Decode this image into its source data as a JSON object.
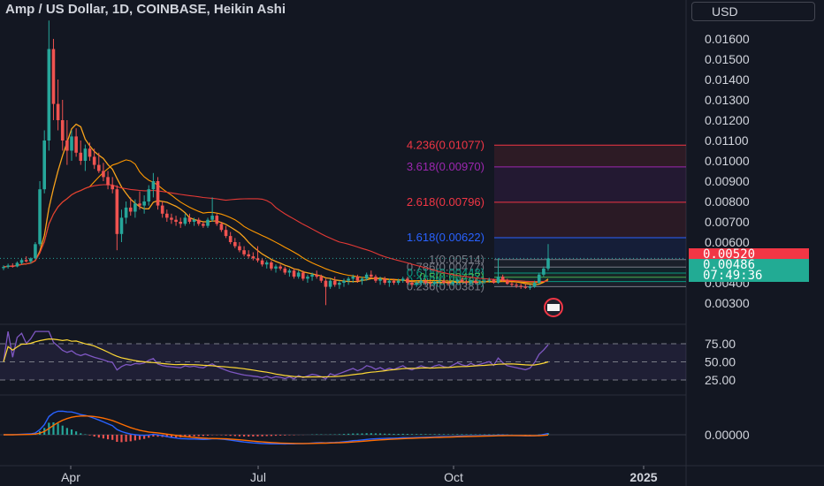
{
  "header": {
    "title": "Amp / US Dollar, 1D, COINBASE, Heikin Ashi",
    "currency_button": "USD"
  },
  "price_axis": {
    "ticks": [
      "0.01600",
      "0.01500",
      "0.01400",
      "0.01300",
      "0.01200",
      "0.01100",
      "0.01000",
      "0.00900",
      "0.00800",
      "0.00700",
      "0.00600",
      "0.00500",
      "0.00400",
      "0.00300"
    ],
    "last_price_tag": "0.00520",
    "close_price_tag": "0.00486",
    "countdown": "07:49:36",
    "last_color": "#f23645",
    "close_color": "#22ab94"
  },
  "fibonacci": {
    "labels": [
      "4.236(0.01077)",
      "3.618(0.00970)",
      "2.618(0.00796)",
      "1.618(0.00622)",
      "1(0.00514)",
      "0.786(0.00477)",
      "0.618(0.00448)",
      "0.5(0.00427)",
      "0.382(0.00406)",
      "0.236(0.00381)"
    ],
    "colors": [
      "#f23645",
      "#9c27b0",
      "#f23645",
      "#2962ff",
      "#787b86",
      "#787b86",
      "#089981",
      "#4caf50",
      "#089981",
      "#787b86"
    ]
  },
  "rsi": {
    "ticks": [
      "75.00",
      "50.00",
      "25.00"
    ],
    "line_color": "#7e57c2",
    "ma_color": "#fdd835"
  },
  "macd": {
    "ticks": [
      "0.00000"
    ],
    "macd_color": "#2962ff",
    "signal_color": "#ff6d00"
  },
  "time_axis": {
    "labels": [
      "Apr",
      "Jul",
      "Oct",
      "2025"
    ]
  },
  "chart_data": {
    "type": "candlestick",
    "symbol": "Amp / US Dollar",
    "interval": "1D",
    "exchange": "COINBASE",
    "style": "Heikin Ashi",
    "x_labels": [
      "Apr",
      "Jul",
      "Oct",
      "2025"
    ],
    "ylim": [
      0.00275,
      0.0173
    ],
    "candles_ohlc": [
      [
        0.00472,
        0.00486,
        0.00462,
        0.00478
      ],
      [
        0.00478,
        0.00494,
        0.0047,
        0.00485
      ],
      [
        0.00485,
        0.00496,
        0.00474,
        0.0048
      ],
      [
        0.0048,
        0.00505,
        0.00476,
        0.00498
      ],
      [
        0.00498,
        0.0052,
        0.0049,
        0.00512
      ],
      [
        0.00512,
        0.0053,
        0.005,
        0.00505
      ],
      [
        0.00505,
        0.00525,
        0.00495,
        0.0052
      ],
      [
        0.0052,
        0.006,
        0.00515,
        0.0059
      ],
      [
        0.0059,
        0.009,
        0.0058,
        0.0086
      ],
      [
        0.0086,
        0.0115,
        0.0084,
        0.011
      ],
      [
        0.011,
        0.0169,
        0.0105,
        0.0155
      ],
      [
        0.0155,
        0.016,
        0.012,
        0.0128
      ],
      [
        0.0128,
        0.014,
        0.0115,
        0.012
      ],
      [
        0.012,
        0.013,
        0.0105,
        0.011
      ],
      [
        0.011,
        0.012,
        0.0098,
        0.0105
      ],
      [
        0.0105,
        0.0115,
        0.01,
        0.0112
      ],
      [
        0.0112,
        0.0116,
        0.0102,
        0.0104
      ],
      [
        0.0104,
        0.011,
        0.0098,
        0.01
      ],
      [
        0.01,
        0.0108,
        0.0095,
        0.0106
      ],
      [
        0.0106,
        0.0109,
        0.01,
        0.0102
      ],
      [
        0.0102,
        0.0106,
        0.0096,
        0.0098
      ],
      [
        0.0098,
        0.0104,
        0.0094,
        0.0095
      ],
      [
        0.0095,
        0.0099,
        0.009,
        0.0092
      ],
      [
        0.0092,
        0.0095,
        0.0086,
        0.0088
      ],
      [
        0.0088,
        0.0092,
        0.0084,
        0.0086
      ],
      [
        0.0086,
        0.0088,
        0.0056,
        0.0064
      ],
      [
        0.0064,
        0.0076,
        0.006,
        0.0072
      ],
      [
        0.0072,
        0.008,
        0.0069,
        0.0077
      ],
      [
        0.0077,
        0.0082,
        0.0073,
        0.0075
      ],
      [
        0.0075,
        0.0081,
        0.0072,
        0.0079
      ],
      [
        0.0079,
        0.0085,
        0.0076,
        0.0078
      ],
      [
        0.0078,
        0.0083,
        0.0074,
        0.008
      ],
      [
        0.008,
        0.0088,
        0.0078,
        0.0086
      ],
      [
        0.0086,
        0.0094,
        0.0082,
        0.009
      ],
      [
        0.009,
        0.0092,
        0.0076,
        0.0078
      ],
      [
        0.0078,
        0.008,
        0.0072,
        0.0074
      ],
      [
        0.0074,
        0.0076,
        0.007,
        0.0072
      ],
      [
        0.0072,
        0.0074,
        0.0069,
        0.0071
      ],
      [
        0.0071,
        0.0073,
        0.0068,
        0.007
      ],
      [
        0.007,
        0.0072,
        0.0067,
        0.0069
      ],
      [
        0.0069,
        0.0074,
        0.0068,
        0.0072
      ],
      [
        0.0072,
        0.0074,
        0.0069,
        0.007
      ],
      [
        0.007,
        0.0072,
        0.0068,
        0.0071
      ],
      [
        0.0071,
        0.0072,
        0.0068,
        0.0069
      ],
      [
        0.0069,
        0.007,
        0.0067,
        0.0068
      ],
      [
        0.0068,
        0.0072,
        0.0067,
        0.0071
      ],
      [
        0.0071,
        0.0082,
        0.007,
        0.0073
      ],
      [
        0.0073,
        0.0074,
        0.0068,
        0.0069
      ],
      [
        0.0069,
        0.007,
        0.0065,
        0.0066
      ],
      [
        0.0066,
        0.0068,
        0.0062,
        0.0063
      ],
      [
        0.0063,
        0.0065,
        0.0059,
        0.006
      ],
      [
        0.006,
        0.0062,
        0.0057,
        0.0058
      ],
      [
        0.0058,
        0.006,
        0.0055,
        0.0056
      ],
      [
        0.0056,
        0.0058,
        0.0053,
        0.0054
      ],
      [
        0.0054,
        0.0056,
        0.0052,
        0.0053
      ],
      [
        0.0053,
        0.0055,
        0.0051,
        0.0052
      ],
      [
        0.0052,
        0.0058,
        0.005,
        0.0051
      ],
      [
        0.0051,
        0.0052,
        0.0048,
        0.0049
      ],
      [
        0.0049,
        0.0051,
        0.0047,
        0.005
      ],
      [
        0.005,
        0.0051,
        0.0046,
        0.0047
      ],
      [
        0.0047,
        0.0049,
        0.0045,
        0.0048
      ],
      [
        0.0048,
        0.0049,
        0.0046,
        0.0047
      ],
      [
        0.0047,
        0.0048,
        0.0044,
        0.0045
      ],
      [
        0.0045,
        0.0047,
        0.0043,
        0.0046
      ],
      [
        0.0046,
        0.0047,
        0.0042,
        0.0043
      ],
      [
        0.0043,
        0.0046,
        0.0042,
        0.0045
      ],
      [
        0.0045,
        0.0046,
        0.0041,
        0.0042
      ],
      [
        0.0042,
        0.0044,
        0.004,
        0.0043
      ],
      [
        0.0043,
        0.0045,
        0.0041,
        0.0044
      ],
      [
        0.0044,
        0.0046,
        0.0042,
        0.0043
      ],
      [
        0.0043,
        0.0044,
        0.004,
        0.0041
      ],
      [
        0.0041,
        0.0042,
        0.0029,
        0.0038
      ],
      [
        0.0038,
        0.0042,
        0.0037,
        0.0041
      ],
      [
        0.0041,
        0.0043,
        0.0038,
        0.0039
      ],
      [
        0.0039,
        0.0041,
        0.0037,
        0.004
      ],
      [
        0.004,
        0.0042,
        0.0038,
        0.0041
      ],
      [
        0.0041,
        0.0043,
        0.0039,
        0.0042
      ],
      [
        0.0042,
        0.0044,
        0.004,
        0.0043
      ],
      [
        0.0043,
        0.0044,
        0.004,
        0.0041
      ],
      [
        0.0041,
        0.0043,
        0.0039,
        0.0042
      ],
      [
        0.0042,
        0.0045,
        0.0041,
        0.0044
      ],
      [
        0.0044,
        0.0046,
        0.0042,
        0.0043
      ],
      [
        0.0043,
        0.0044,
        0.004,
        0.0041
      ],
      [
        0.0041,
        0.0043,
        0.0039,
        0.0042
      ],
      [
        0.0042,
        0.0043,
        0.0039,
        0.004
      ],
      [
        0.004,
        0.0042,
        0.0038,
        0.0041
      ],
      [
        0.0041,
        0.0042,
        0.0039,
        0.004
      ],
      [
        0.004,
        0.0042,
        0.0039,
        0.0041
      ],
      [
        0.0041,
        0.0043,
        0.004,
        0.0042
      ],
      [
        0.0042,
        0.0043,
        0.0039,
        0.004
      ],
      [
        0.004,
        0.0041,
        0.0038,
        0.0039
      ],
      [
        0.0039,
        0.0041,
        0.0038,
        0.004
      ],
      [
        0.004,
        0.0042,
        0.0039,
        0.0041
      ],
      [
        0.0041,
        0.0042,
        0.0039,
        0.004
      ],
      [
        0.004,
        0.0041,
        0.0038,
        0.00395
      ],
      [
        0.00395,
        0.0041,
        0.00385,
        0.00405
      ],
      [
        0.00405,
        0.0042,
        0.00395,
        0.0041
      ],
      [
        0.0041,
        0.0042,
        0.00395,
        0.004
      ],
      [
        0.004,
        0.0041,
        0.00385,
        0.00395
      ],
      [
        0.00395,
        0.0041,
        0.00385,
        0.00405
      ],
      [
        0.00405,
        0.0042,
        0.00395,
        0.00415
      ],
      [
        0.00415,
        0.00425,
        0.004,
        0.00405
      ],
      [
        0.00405,
        0.00415,
        0.0039,
        0.004
      ],
      [
        0.004,
        0.00415,
        0.0039,
        0.0041
      ],
      [
        0.0041,
        0.0042,
        0.00395,
        0.004
      ],
      [
        0.004,
        0.00415,
        0.0039,
        0.00405
      ],
      [
        0.00405,
        0.0042,
        0.00395,
        0.0041
      ],
      [
        0.0041,
        0.00425,
        0.004,
        0.00415
      ],
      [
        0.00415,
        0.0042,
        0.00395,
        0.004
      ],
      [
        0.004,
        0.0052,
        0.00395,
        0.0043
      ],
      [
        0.0043,
        0.0044,
        0.00405,
        0.0041
      ],
      [
        0.0041,
        0.0042,
        0.0039,
        0.00395
      ],
      [
        0.00395,
        0.00405,
        0.0038,
        0.0039
      ],
      [
        0.0039,
        0.004,
        0.00375,
        0.00385
      ],
      [
        0.00385,
        0.00395,
        0.0037,
        0.0038
      ],
      [
        0.0038,
        0.00395,
        0.0037,
        0.00375
      ],
      [
        0.00375,
        0.0039,
        0.00365,
        0.0038
      ],
      [
        0.0038,
        0.0041,
        0.00375,
        0.004
      ],
      [
        0.004,
        0.0045,
        0.00395,
        0.0044
      ],
      [
        0.0044,
        0.0048,
        0.0043,
        0.0047
      ],
      [
        0.0047,
        0.0059,
        0.0046,
        0.0052
      ]
    ]
  }
}
